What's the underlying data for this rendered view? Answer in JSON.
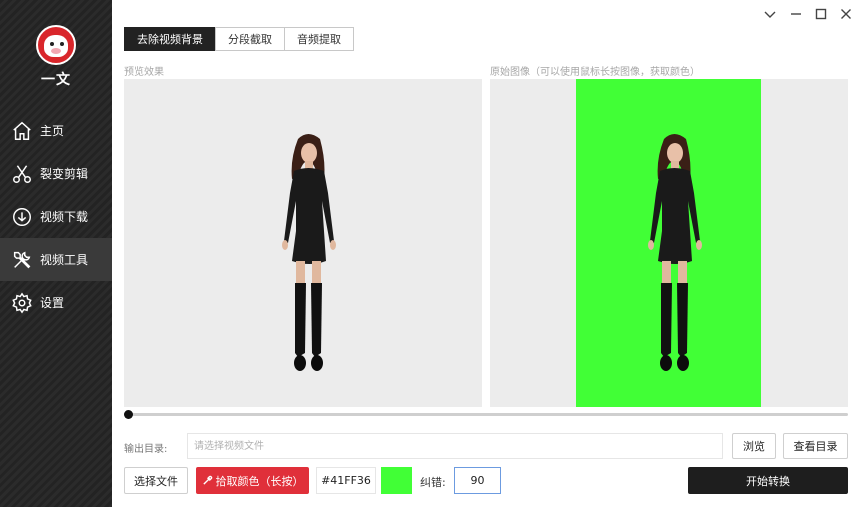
{
  "app": {
    "name": "一文"
  },
  "sidebar": {
    "items": [
      {
        "label": "主页",
        "icon": "home-icon"
      },
      {
        "label": "裂变剪辑",
        "icon": "scissors-icon"
      },
      {
        "label": "视频下载",
        "icon": "download-icon"
      },
      {
        "label": "视频工具",
        "icon": "tools-icon",
        "active": true
      },
      {
        "label": "设置",
        "icon": "gear-icon"
      }
    ]
  },
  "tabs": [
    {
      "label": "去除视频背景",
      "active": true
    },
    {
      "label": "分段截取"
    },
    {
      "label": "音频提取"
    }
  ],
  "preview": {
    "label": "预览效果"
  },
  "original": {
    "label": "原始图像（可以使用鼠标长按图像，获取颜色）"
  },
  "slider": {
    "position": 0
  },
  "output": {
    "label": "输出目录:",
    "placeholder": "请选择视频文件",
    "browse_label": "浏览",
    "view_label": "查看目录"
  },
  "controls": {
    "select_file_label": "选择文件",
    "pick_color_label": "拾取颜色（长按）",
    "color_code": "#41FF36",
    "tolerance_label": "纠错:",
    "tolerance_value": "90",
    "start_label": "开始转换"
  },
  "colors": {
    "accent_red": "#e0303a",
    "key_green": "#41ff36",
    "sidebar_bg": "#262626",
    "dark_button": "#1e1e1e"
  }
}
